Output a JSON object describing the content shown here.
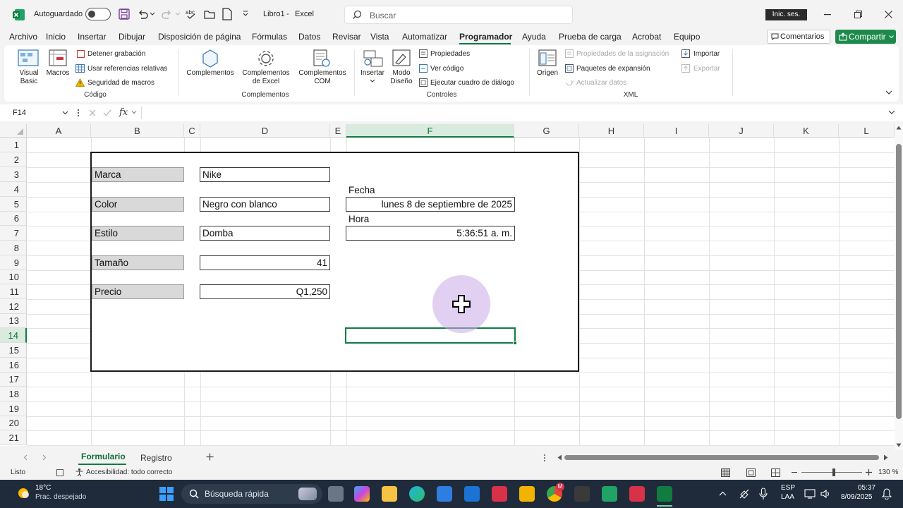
{
  "titlebar": {
    "autosave_label": "Autoguardado",
    "filename": "Libro1",
    "separator": "-",
    "app_name": "Excel",
    "search_placeholder": "Buscar",
    "signin_label": "Inic. ses."
  },
  "menu": {
    "tabs": [
      "Archivo",
      "Inicio",
      "Insertar",
      "Dibujar",
      "Disposición de página",
      "Fórmulas",
      "Datos",
      "Revisar",
      "Vista",
      "Automatizar",
      "Programador",
      "Ayuda",
      "Prueba de carga",
      "Acrobat",
      "Equipo"
    ],
    "active_tab": "Programador",
    "comments_label": "Comentarios",
    "share_label": "Compartir"
  },
  "ribbon": {
    "codigo": {
      "group_label": "Código",
      "visual_basic": [
        "Visual",
        "Basic"
      ],
      "macros": "Macros",
      "stop_recording": "Detener grabación",
      "relative_refs": "Usar referencias relativas",
      "macro_security": "Seguridad de macros"
    },
    "complementos": {
      "group_label": "Complementos",
      "complementos": "Complementos",
      "excel_addins": [
        "Complementos",
        "de Excel"
      ],
      "com_addins": [
        "Complementos",
        "COM"
      ]
    },
    "controles": {
      "group_label": "Controles",
      "insertar": "Insertar",
      "design_mode": [
        "Modo",
        "Diseño"
      ],
      "properties": "Propiedades",
      "view_code": "Ver código",
      "run_dialog": "Ejecutar cuadro de diálogo"
    },
    "xml": {
      "group_label": "XML",
      "source": "Origen",
      "map_properties": "Propiedades de la asignación",
      "expansion_packs": "Paquetes de expansión",
      "refresh_data": "Actualizar datos",
      "import": "Importar",
      "export": "Exportar"
    }
  },
  "formula_bar": {
    "name_box": "F14",
    "formula_value": ""
  },
  "sheet": {
    "columns": [
      "A",
      "B",
      "C",
      "D",
      "E",
      "F",
      "G",
      "H",
      "I",
      "J",
      "K",
      "L"
    ],
    "selected_column": "F",
    "rows": [
      "1",
      "2",
      "3",
      "4",
      "5",
      "6",
      "7",
      "8",
      "9",
      "10",
      "11",
      "12",
      "13",
      "14",
      "15",
      "16",
      "17",
      "18",
      "19",
      "20",
      "21"
    ],
    "selected_row": "14",
    "form": {
      "fields": [
        {
          "label": "Marca",
          "value": "Nike",
          "align": "left"
        },
        {
          "label": "Color",
          "value": "Negro con blanco",
          "align": "left"
        },
        {
          "label": "Estilo",
          "value": "Domba",
          "align": "left"
        },
        {
          "label": "Tamaño",
          "value": "41",
          "align": "right"
        },
        {
          "label": "Precio",
          "value": "Q1,250",
          "align": "right"
        }
      ],
      "fecha_label": "Fecha",
      "fecha_value": "lunes 8 de septiembre de 2025",
      "hora_label": "Hora",
      "hora_value": "5:36:51 a. m."
    }
  },
  "sheet_tabs": {
    "tabs": [
      "Formulario",
      "Registro"
    ],
    "active": "Formulario"
  },
  "status": {
    "ready": "Listo",
    "accessibility": "Accesibilidad: todo correcto",
    "zoom": "130 %"
  },
  "taskbar": {
    "temperature": "18°C",
    "weather": "Prac. despejado",
    "search_placeholder": "Búsqueda rápida",
    "language": "ESP",
    "keyboard": "LAA",
    "time": "05:37",
    "date": "8/09/2025",
    "badge_count": "M"
  },
  "colors": {
    "excel_green": "#107c41",
    "share_green": "#1d8a4c",
    "taskbar": "#1f2b3a",
    "label_fill": "#d9d9d9"
  }
}
